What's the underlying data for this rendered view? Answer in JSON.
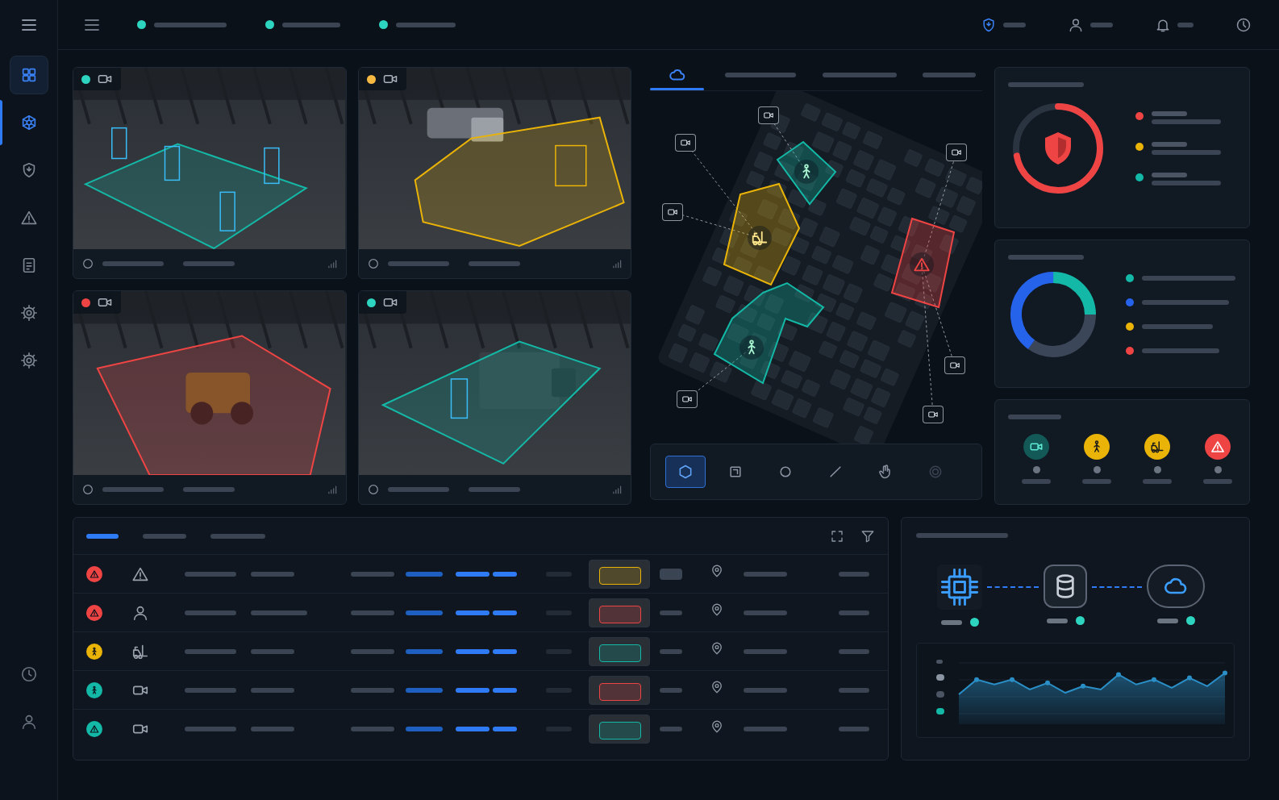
{
  "sidebar": {
    "items": [
      {
        "kind": "grid",
        "selected": false,
        "highlighted": true
      },
      {
        "kind": "hub",
        "selected": true,
        "highlighted": false
      },
      {
        "kind": "shield",
        "selected": false,
        "highlighted": false
      },
      {
        "kind": "alert",
        "selected": false,
        "highlighted": false
      },
      {
        "kind": "report",
        "selected": false,
        "highlighted": false
      },
      {
        "kind": "gear",
        "selected": false,
        "highlighted": false
      },
      {
        "kind": "gear",
        "selected": false,
        "highlighted": false
      }
    ],
    "footer": [
      {
        "kind": "power"
      },
      {
        "kind": "user"
      }
    ]
  },
  "topbar": {
    "status": [
      {
        "color": "#2dd4bf"
      },
      {
        "color": "#2dd4bf"
      },
      {
        "color": "#2dd4bf"
      }
    ],
    "icons": [
      {
        "kind": "shield",
        "color": "#3b82f6"
      },
      {
        "kind": "user",
        "color": "#8b95a3"
      },
      {
        "kind": "bell",
        "color": "#8b95a3"
      },
      {
        "kind": "clock",
        "color": "#8b95a3"
      }
    ]
  },
  "cameras": [
    {
      "status_color": "#2dd4bf",
      "zone_color": "#14b8a6",
      "zone": "quad",
      "detections": 4
    },
    {
      "status_color": "#f5b942",
      "zone_color": "#eab308",
      "zone": "hex",
      "detections": 1
    },
    {
      "status_color": "#ef4444",
      "zone_color": "#ef4444",
      "zone": "wide",
      "detections": 0
    },
    {
      "status_color": "#2dd4bf",
      "zone_color": "#14b8a6",
      "zone": "lane",
      "detections": 1
    }
  ],
  "map": {
    "tabs": [
      {
        "selected": true
      },
      {
        "selected": false
      },
      {
        "selected": false
      },
      {
        "selected": false
      }
    ],
    "zones": [
      {
        "kind": "person",
        "color": "#14b8a6"
      },
      {
        "kind": "forklift",
        "color": "#eab308"
      },
      {
        "kind": "alert",
        "color": "#ef4444"
      },
      {
        "kind": "person",
        "color": "#14b8a6"
      }
    ],
    "tools": [
      {
        "kind": "polygon",
        "selected": true,
        "disabled": false
      },
      {
        "kind": "square",
        "selected": false,
        "disabled": false
      },
      {
        "kind": "circle",
        "selected": false,
        "disabled": false
      },
      {
        "kind": "line",
        "selected": false,
        "disabled": false
      },
      {
        "kind": "hand",
        "selected": false,
        "disabled": false
      },
      {
        "kind": "target",
        "selected": false,
        "disabled": true
      }
    ]
  },
  "risk": {
    "level": 0.72,
    "color": "#ef4444",
    "legend": [
      {
        "color": "#ef4444"
      },
      {
        "color": "#eab308"
      },
      {
        "color": "#14b8a6"
      }
    ]
  },
  "distribution": {
    "segments": [
      {
        "color": "#14b8a6",
        "level": 0.25
      },
      {
        "color": "#3b4658",
        "level": 0.35
      },
      {
        "color": "#2563eb",
        "level": 0.4
      }
    ],
    "legend": [
      {
        "color": "#14b8a6"
      },
      {
        "color": "#2563eb"
      },
      {
        "color": "#eab308"
      },
      {
        "color": "#ef4444"
      }
    ]
  },
  "indicators": [
    {
      "kind": "camera",
      "color": "#14b8a6"
    },
    {
      "kind": "person",
      "color": "#eab308"
    },
    {
      "kind": "forklift",
      "color": "#eab308"
    },
    {
      "kind": "alert",
      "color": "#ef4444"
    }
  ],
  "events": {
    "tabs": [
      {
        "selected": true
      },
      {
        "selected": false
      },
      {
        "selected": false
      }
    ],
    "rows": [
      {
        "severity": "alert",
        "severity_color": "#ef4444",
        "type": "alert",
        "thumb_color": "#eab308"
      },
      {
        "severity": "alert",
        "severity_color": "#ef4444",
        "type": "user",
        "thumb_color": "#ef4444"
      },
      {
        "severity": "person",
        "severity_color": "#eab308",
        "type": "forklift",
        "thumb_color": "#14b8a6"
      },
      {
        "severity": "person",
        "severity_color": "#14b8a6",
        "type": "camera",
        "thumb_color": "#ef4444"
      },
      {
        "severity": "alert",
        "severity_color": "#14b8a6",
        "type": "camera",
        "thumb_color": "#14b8a6"
      }
    ]
  },
  "pipeline": {
    "nodes": [
      {
        "kind": "chip",
        "status_color": "#2dd4bf"
      },
      {
        "kind": "db",
        "status_color": "#2dd4bf"
      },
      {
        "kind": "cloud",
        "status_color": "#2dd4bf"
      }
    ],
    "series": {
      "color": "#2b8fc7",
      "values": [
        18,
        27,
        24,
        27,
        21,
        25,
        19,
        23,
        21,
        30,
        24,
        27,
        22,
        28,
        23,
        31
      ]
    }
  }
}
